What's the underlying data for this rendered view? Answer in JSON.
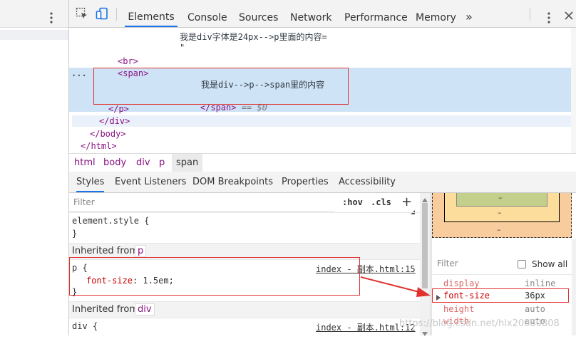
{
  "toolbar": {
    "tabs": [
      "Elements",
      "Console",
      "Sources",
      "Network",
      "Performance",
      "Memory"
    ],
    "more": "»"
  },
  "tree": {
    "line1": "我是div字体是24px-->p里面的内容=",
    "line1b": "\"",
    "br": "<br>",
    "span_open": "<span>",
    "span_text": "我是div-->p-->span里的内容",
    "span_close": "</span>",
    "span_eq": " == $0",
    "p_close": "</p>",
    "div_close": "</div>",
    "body_close": "</body>",
    "html_close": "</html>",
    "dots": "..."
  },
  "breadcrumb": [
    "html",
    "body",
    "div",
    "p",
    "span"
  ],
  "subtabs": [
    "Styles",
    "Event Listeners",
    "DOM Breakpoints",
    "Properties",
    "Accessibility"
  ],
  "styles": {
    "filter_placeholder": "Filter",
    "hov": ":hov",
    "cls": ".cls",
    "plus": "+",
    "element_style": "element.style {",
    "close_brace": "}",
    "inherited1_label": "Inherited from",
    "inherited1_tag": "p",
    "rule1_selector": "p {",
    "rule1_source": "index - 副本.html:15",
    "rule1_prop": "font-size",
    "rule1_value": "1.5em;",
    "inherited2_label": "Inherited from",
    "inherited2_tag": "div",
    "rule2_selector": "div {",
    "rule2_source": "index - 副本.html:12"
  },
  "computed": {
    "filter_placeholder": "Filter",
    "show_all": "Show all",
    "box_dash": "–",
    "rows": [
      {
        "prop": "display",
        "value": "inline"
      },
      {
        "prop": "font-size",
        "value": "36px"
      },
      {
        "prop": "height",
        "value": "auto"
      },
      {
        "prop": "width",
        "value": "auto"
      }
    ],
    "watermark": "https://blog.csdn.net/hlx20080808"
  },
  "colors": {
    "tag": "#881280",
    "active_tab": "#1a73e8",
    "selection": "#cfe3f7",
    "annotation_red": "#e0322f"
  }
}
